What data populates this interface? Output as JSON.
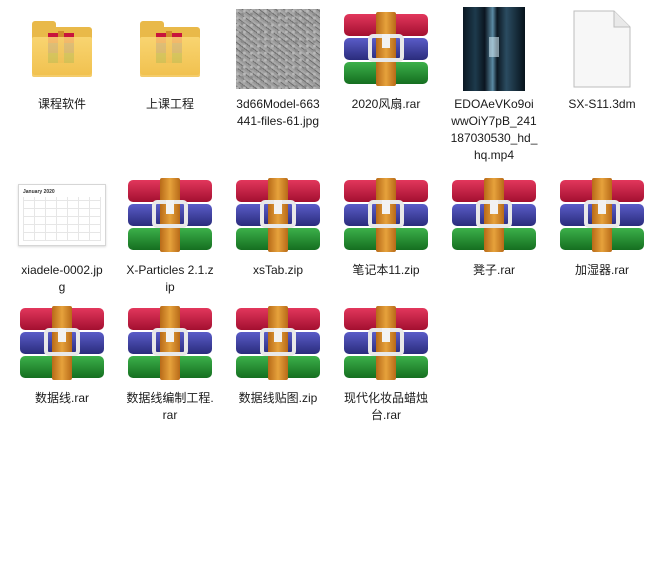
{
  "files": [
    {
      "name": "课程软件",
      "type": "folder"
    },
    {
      "name": "上课工程",
      "type": "folder"
    },
    {
      "name": "3d66Model-663441-files-61.jpg",
      "type": "image-texture"
    },
    {
      "name": "2020风扇.rar",
      "type": "rar"
    },
    {
      "name": "EDOAeVKo9oiwwOiY7pB_241187030530_hd_hq.mp4",
      "type": "video"
    },
    {
      "name": "SX-S11.3dm",
      "type": "document"
    },
    {
      "name": "xiadele-0002.jpg",
      "type": "image-calendar",
      "calendar_title": "January 2020"
    },
    {
      "name": "X-Particles 2.1.zip",
      "type": "rar"
    },
    {
      "name": "xsTab.zip",
      "type": "rar"
    },
    {
      "name": "笔记本11.zip",
      "type": "rar"
    },
    {
      "name": "凳子.rar",
      "type": "rar"
    },
    {
      "name": "加湿器.rar",
      "type": "rar"
    },
    {
      "name": "数据线.rar",
      "type": "rar"
    },
    {
      "name": "数据线编制工程.rar",
      "type": "rar"
    },
    {
      "name": "数据线贴图.zip",
      "type": "rar"
    },
    {
      "name": "现代化妆品蜡烛台.rar",
      "type": "rar"
    }
  ],
  "colors": {
    "rar_red": "#c8143c",
    "rar_blue": "#3a3c9c",
    "rar_green": "#1e8a2c",
    "rar_strap": "#d08a2a",
    "folder_yellow": "#f2c24f"
  }
}
